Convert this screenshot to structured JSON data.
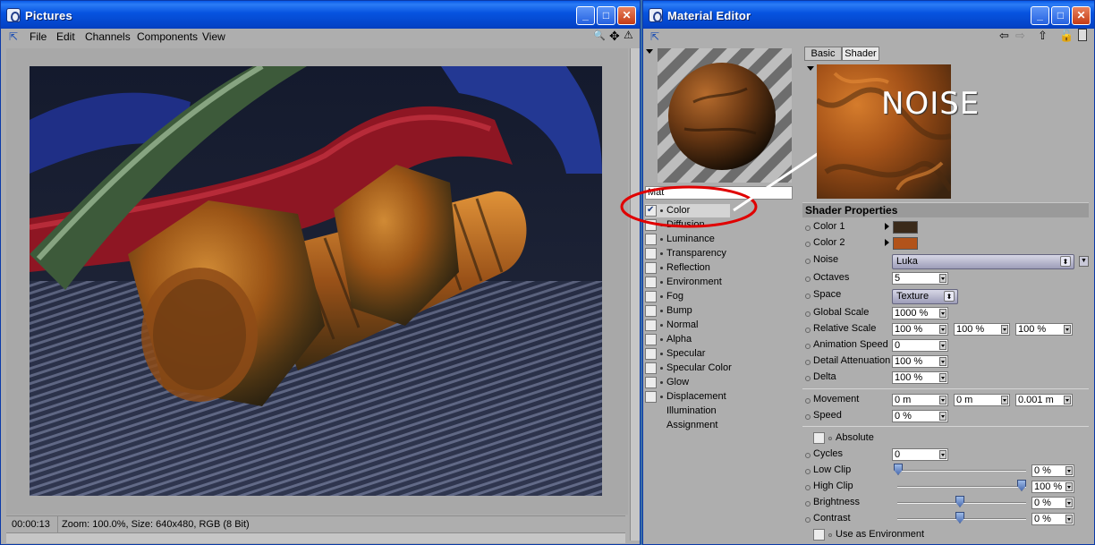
{
  "pictures_window": {
    "title": "Pictures",
    "menu": [
      "File",
      "Edit",
      "Channels",
      "Components",
      "View"
    ],
    "status": {
      "time": "00:00:13",
      "info": "Zoom: 100.0%, Size: 640x480, RGB (8 Bit)"
    }
  },
  "material_window": {
    "title": "Material Editor",
    "tabs": [
      "Basic",
      "Shader"
    ],
    "material_name": "Mat",
    "annotation": "NOISE",
    "channels": [
      {
        "label": "Color",
        "checked": true,
        "has_box": true
      },
      {
        "label": "Diffusion",
        "checked": false,
        "has_box": true
      },
      {
        "label": "Luminance",
        "checked": false,
        "has_box": true
      },
      {
        "label": "Transparency",
        "checked": false,
        "has_box": true
      },
      {
        "label": "Reflection",
        "checked": false,
        "has_box": true
      },
      {
        "label": "Environment",
        "checked": false,
        "has_box": true
      },
      {
        "label": "Fog",
        "checked": false,
        "has_box": true
      },
      {
        "label": "Bump",
        "checked": false,
        "has_box": true
      },
      {
        "label": "Normal",
        "checked": false,
        "has_box": true
      },
      {
        "label": "Alpha",
        "checked": false,
        "has_box": true
      },
      {
        "label": "Specular",
        "checked": false,
        "has_box": true
      },
      {
        "label": "Specular Color",
        "checked": false,
        "has_box": true
      },
      {
        "label": "Glow",
        "checked": false,
        "has_box": true
      },
      {
        "label": "Displacement",
        "checked": false,
        "has_box": true
      },
      {
        "label": "Illumination",
        "checked": false,
        "has_box": false
      },
      {
        "label": "Assignment",
        "checked": false,
        "has_box": false
      }
    ],
    "shader_properties": {
      "header": "Shader Properties",
      "color1_label": "Color 1",
      "color1": "#3a2a1a",
      "color2_label": "Color 2",
      "color2": "#b2531a",
      "noise_label": "Noise",
      "noise_value": "Luka",
      "octaves_label": "Octaves",
      "octaves_value": "5",
      "space_label": "Space",
      "space_value": "Texture",
      "global_scale_label": "Global Scale",
      "global_scale_value": "1000 %",
      "relative_scale_label": "Relative Scale",
      "relative_scale_values": [
        "100 %",
        "100 %",
        "100 %"
      ],
      "animation_speed_label": "Animation Speed",
      "animation_speed_value": "0",
      "detail_attenuation_label": "Detail Attenuation",
      "detail_attenuation_value": "100 %",
      "delta_label": "Delta",
      "delta_value": "100 %",
      "movement_label": "Movement",
      "movement_values": [
        "0 m",
        "0 m",
        "0.001 m"
      ],
      "speed_label": "Speed",
      "speed_value": "0 %",
      "absolute_label": "Absolute",
      "cycles_label": "Cycles",
      "cycles_value": "0",
      "low_clip_label": "Low Clip",
      "low_clip_value": "0 %",
      "low_clip_level": 0,
      "high_clip_label": "High Clip",
      "high_clip_value": "100 %",
      "high_clip_level": 1,
      "brightness_label": "Brightness",
      "brightness_value": "0 %",
      "brightness_level": 0.5,
      "contrast_label": "Contrast",
      "contrast_value": "0 %",
      "contrast_level": 0.5,
      "use_env_label": "Use as Environment"
    }
  }
}
